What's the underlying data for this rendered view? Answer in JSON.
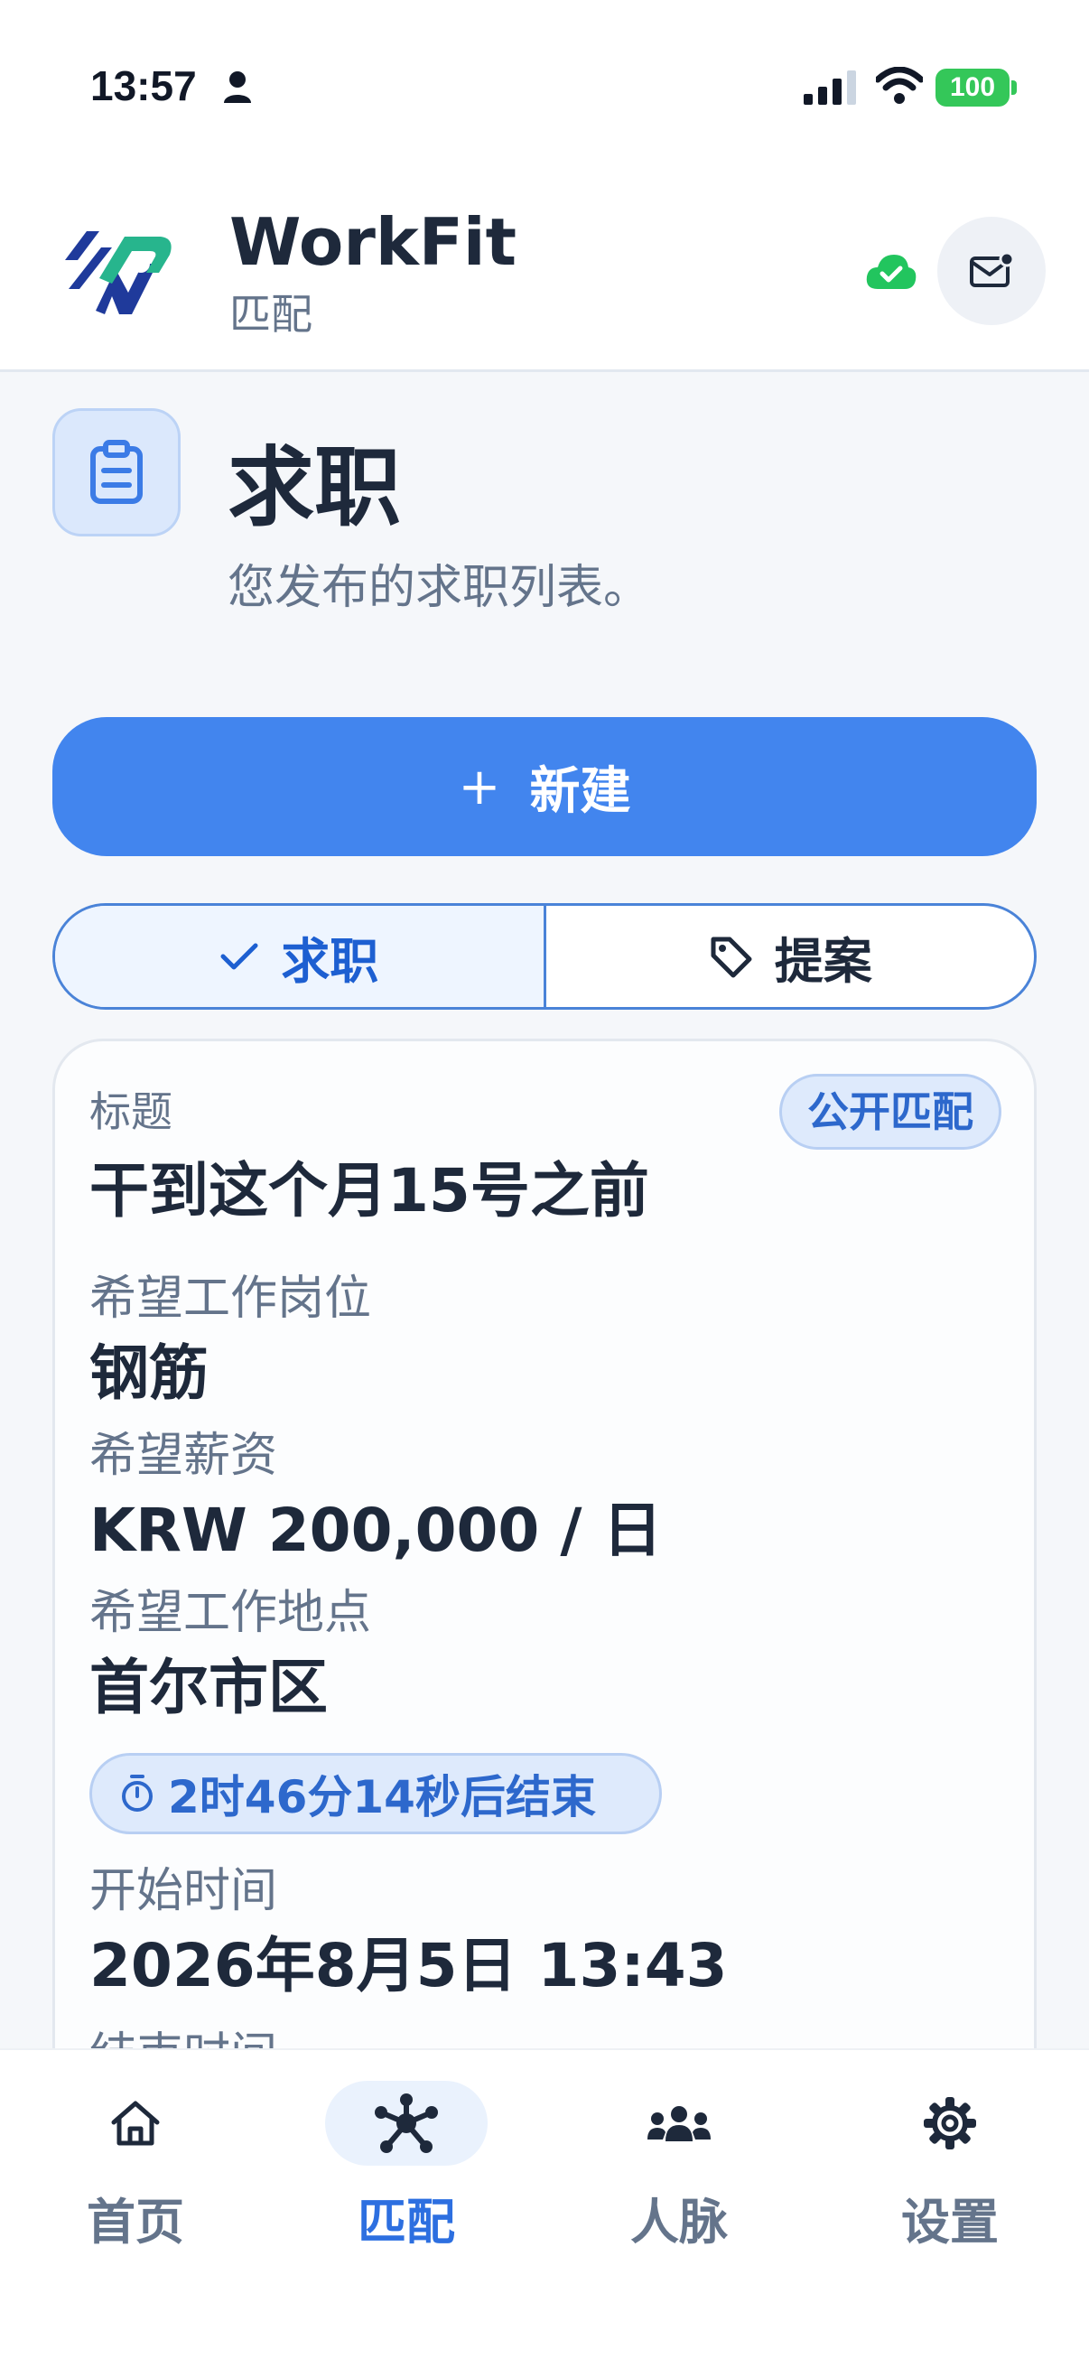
{
  "status_bar": {
    "time": "13:57",
    "battery": "100"
  },
  "header": {
    "title": "WorkFit",
    "subtitle": "匹配"
  },
  "page": {
    "title": "求职",
    "subtitle": "您发布的求职列表。"
  },
  "new_button": {
    "plus": "+",
    "label": "新建"
  },
  "tabs": [
    {
      "label": "求职",
      "active": true,
      "icon": "check-icon"
    },
    {
      "label": "提案",
      "active": false,
      "icon": "tag-icon"
    }
  ],
  "card": {
    "badge": "公开匹配",
    "title_label": "标题",
    "title_value": "干到这个月15号之前",
    "position_label": "希望工作岗位",
    "position_value": "钢筋",
    "salary_label": "希望薪资",
    "salary_value": "KRW 200,000 / 日",
    "location_label": "希望工作地点",
    "location_value": "首尔市区",
    "timer": "2时46分14秒后结束",
    "start_label": "开始时间",
    "start_value": "2026年8月5日 13:43",
    "end_label": "结束时间"
  },
  "nav": [
    {
      "label": "首页",
      "icon": "home-icon",
      "active": false
    },
    {
      "label": "匹配",
      "icon": "network-icon",
      "active": true
    },
    {
      "label": "人脉",
      "icon": "people-icon",
      "active": false
    },
    {
      "label": "设置",
      "icon": "gear-icon",
      "active": false
    }
  ],
  "colors": {
    "accent": "#4285ee",
    "success": "#34c759",
    "muted": "#64748b",
    "text": "#1e293b"
  }
}
